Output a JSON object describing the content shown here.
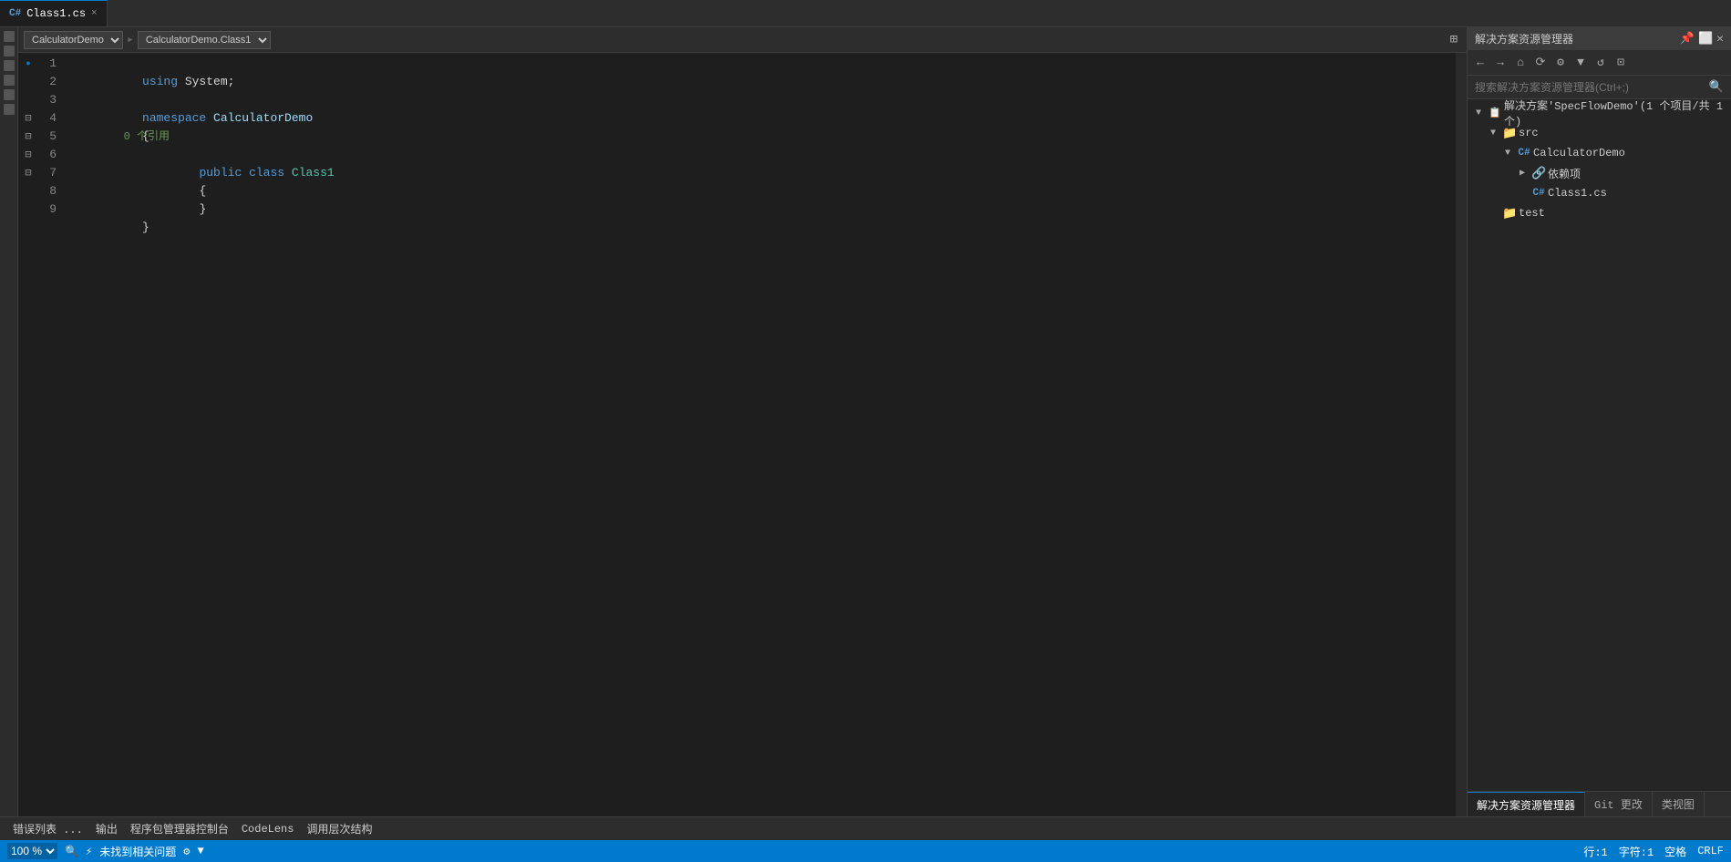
{
  "tab": {
    "filename": "Class1.cs",
    "close_icon": "×"
  },
  "editor_header": {
    "project_dropdown": "CalculatorDemo",
    "class_dropdown": "CalculatorDemo.Class1"
  },
  "code_lines": [
    {
      "num": 1,
      "indicator": "🔵",
      "text_parts": [
        {
          "t": "using",
          "cls": "kw"
        },
        {
          "t": " System;",
          "cls": ""
        }
      ]
    },
    {
      "num": 2,
      "indicator": "",
      "text_parts": []
    },
    {
      "num": 3,
      "indicator": "",
      "text_parts": [
        {
          "t": "namespace",
          "cls": "kw"
        },
        {
          "t": " CalculatorDemo",
          "cls": "ns"
        }
      ]
    },
    {
      "num": 4,
      "indicator": "⊟",
      "text_parts": [
        {
          "t": "{",
          "cls": ""
        }
      ]
    },
    {
      "num": 5,
      "indicator": "⊟",
      "text_parts": [
        {
          "t": "        ",
          "cls": ""
        },
        {
          "t": "public",
          "cls": "kw"
        },
        {
          "t": " ",
          "cls": ""
        },
        {
          "t": "class",
          "cls": "kw"
        },
        {
          "t": " ",
          "cls": ""
        },
        {
          "t": "Class1",
          "cls": "cls"
        }
      ]
    },
    {
      "num": 6,
      "indicator": "⊟",
      "text_parts": [
        {
          "t": "        {",
          "cls": ""
        }
      ]
    },
    {
      "num": 7,
      "indicator": "⊟",
      "text_parts": [
        {
          "t": "        }",
          "cls": ""
        }
      ]
    },
    {
      "num": 8,
      "indicator": "",
      "text_parts": [
        {
          "t": "}",
          "cls": ""
        }
      ]
    },
    {
      "num": 9,
      "indicator": "",
      "text_parts": []
    }
  ],
  "comment_line4": "0 个引用",
  "solution_explorer": {
    "title": "解决方案资源管理器",
    "search_placeholder": "搜索解决方案资源管理器(Ctrl+;)",
    "solution_label": "解决方案'SpecFlowDemo'(1 个项目/共 1 个)",
    "tree": [
      {
        "level": 0,
        "icon": "📁",
        "label": "src",
        "arrow": "▲",
        "expanded": true
      },
      {
        "level": 1,
        "icon": "📦",
        "label": "CalculatorDemo",
        "arrow": "▼",
        "expanded": true
      },
      {
        "level": 2,
        "icon": "🔗",
        "label": "依赖项",
        "arrow": "▶",
        "expanded": false
      },
      {
        "level": 2,
        "icon": "C#",
        "label": "Class1.cs",
        "arrow": "",
        "expanded": false
      },
      {
        "level": 0,
        "icon": "📁",
        "label": "test",
        "arrow": "",
        "expanded": false
      }
    ],
    "bottom_tabs": [
      {
        "label": "解决方案资源管理器",
        "active": true
      },
      {
        "label": "Git 更改",
        "active": false
      },
      {
        "label": "类视图",
        "active": false
      }
    ]
  },
  "status_bar": {
    "zoom": "100 %",
    "error_icon": "⚡",
    "errors_label": "未找到相关问题",
    "row_label": "行:1",
    "col_label": "字符:1",
    "encoding": "空格",
    "line_ending": "CRLF"
  },
  "bottom_toolbar": {
    "items": [
      "错误列表 ...",
      "输出",
      "程序包管理器控制台",
      "CodeLens",
      "调用层次结构"
    ]
  }
}
